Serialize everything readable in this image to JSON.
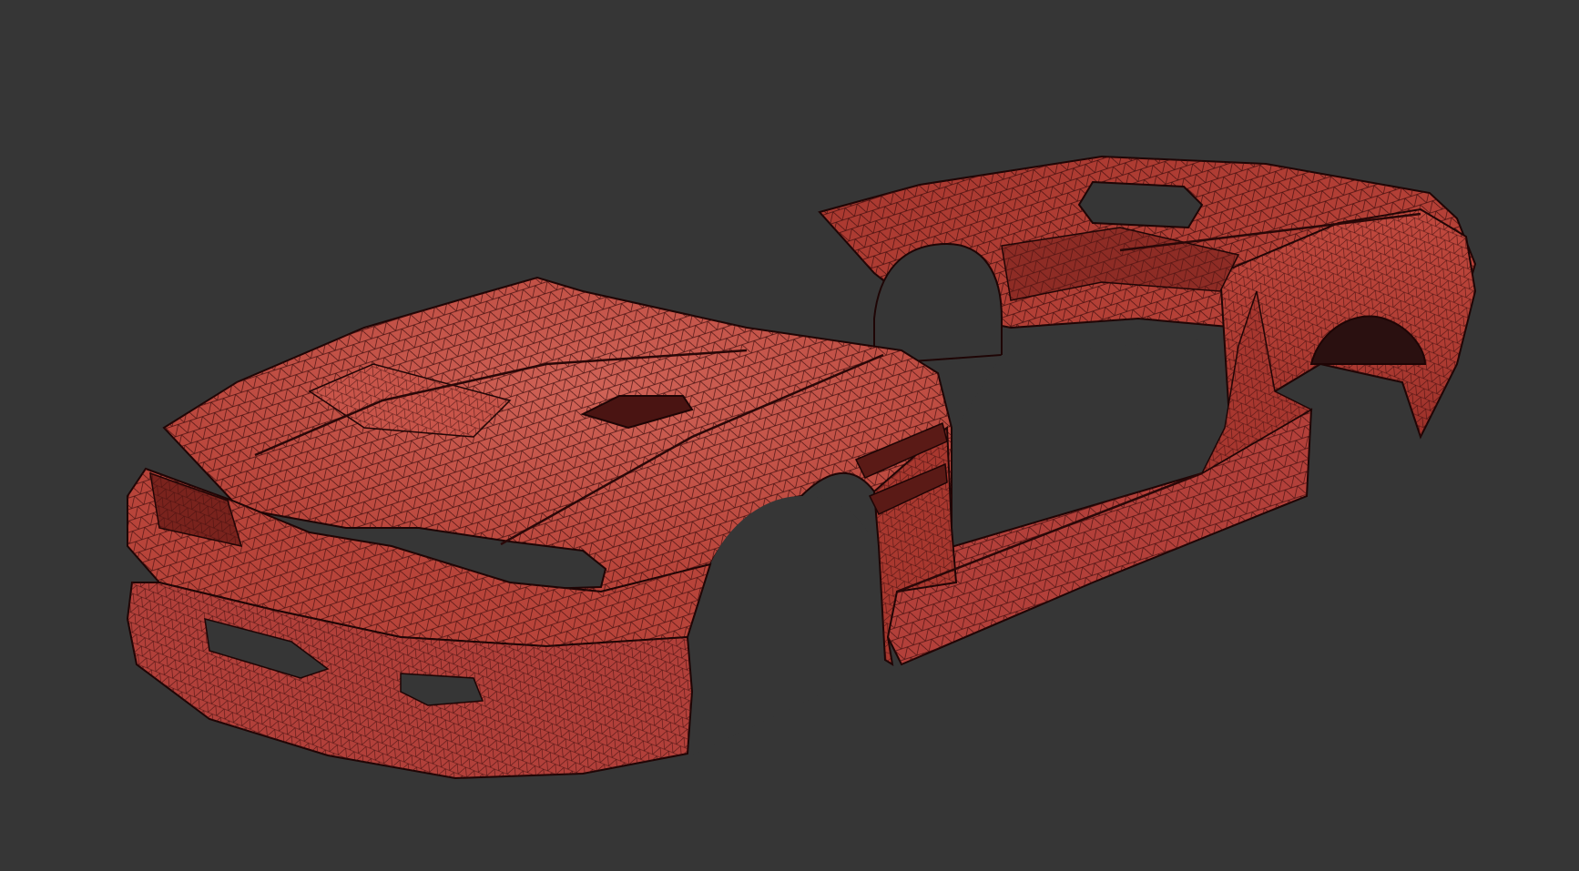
{
  "viewport": {
    "background_color": "#363636",
    "render_mode": "wireframe-on-shaded"
  },
  "model": {
    "surface_color": "#b9443a",
    "highlight_color": "#d46a5c",
    "wire_color": "#3a0b0b",
    "edge_color": "#1e0505",
    "parts": [
      {
        "name": "front-bumper-hood-fenders"
      },
      {
        "name": "rear-body-quarter-panels"
      },
      {
        "name": "side-skirt"
      }
    ]
  }
}
